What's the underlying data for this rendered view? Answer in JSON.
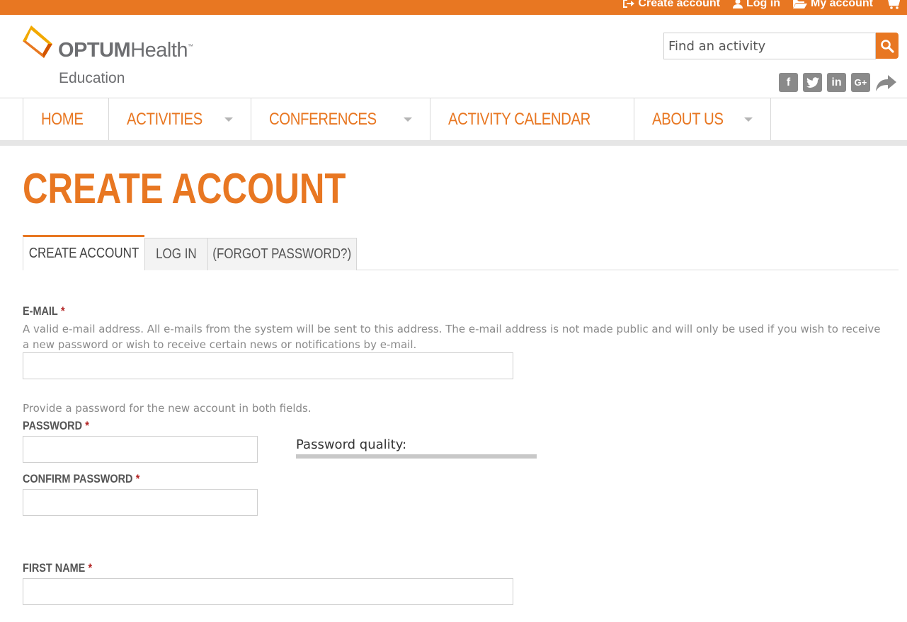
{
  "colors": {
    "brand_orange": "#e87722",
    "icon_gray": "#8a8a8a",
    "required_red": "#b22222"
  },
  "topbar": {
    "links": [
      {
        "label": "Create account",
        "icon": "sign-in-icon"
      },
      {
        "label": "Log in",
        "icon": "user-icon"
      },
      {
        "label": "My account",
        "icon": "folder-open-icon"
      },
      {
        "label": "",
        "icon": "cart-icon"
      }
    ]
  },
  "logo": {
    "brand_bold": "OPTUM",
    "brand_light": "Health",
    "tm": "™",
    "subtitle": "Education"
  },
  "search": {
    "placeholder": "Find an activity",
    "icon": "search-icon"
  },
  "social": [
    {
      "icon": "facebook-icon",
      "glyph": "f"
    },
    {
      "icon": "twitter-icon",
      "glyph": "t"
    },
    {
      "icon": "linkedin-icon",
      "glyph": "in"
    },
    {
      "icon": "google-plus-icon",
      "glyph": "G+"
    },
    {
      "icon": "share-icon",
      "glyph": ""
    }
  ],
  "nav": {
    "items": [
      {
        "label": "HOME",
        "dropdown": false
      },
      {
        "label": "ACTIVITIES",
        "dropdown": true
      },
      {
        "label": "CONFERENCES",
        "dropdown": true
      },
      {
        "label": "ACTIVITY CALENDAR",
        "dropdown": false
      },
      {
        "label": "ABOUT US",
        "dropdown": true
      }
    ]
  },
  "page": {
    "title": "CREATE ACCOUNT"
  },
  "tabs": [
    {
      "label": "CREATE ACCOUNT",
      "active": true
    },
    {
      "label": "LOG IN",
      "active": false
    },
    {
      "label": "(FORGOT PASSWORD?)",
      "active": false
    }
  ],
  "form": {
    "required_marker": "*",
    "email": {
      "label": "E-MAIL",
      "description": "A valid e-mail address. All e-mails from the system will be sent to this address. The e-mail address is not made public and will only be used if you wish to receive a new password or wish to receive certain news or notifications by e-mail.",
      "value": ""
    },
    "password_intro": "Provide a password for the new account in both fields.",
    "password": {
      "label": "PASSWORD",
      "value": ""
    },
    "password_quality": {
      "label": "Password quality:",
      "level": 0
    },
    "confirm_password": {
      "label": "CONFIRM PASSWORD",
      "value": ""
    },
    "first_name": {
      "label": "FIRST NAME",
      "value": ""
    }
  }
}
